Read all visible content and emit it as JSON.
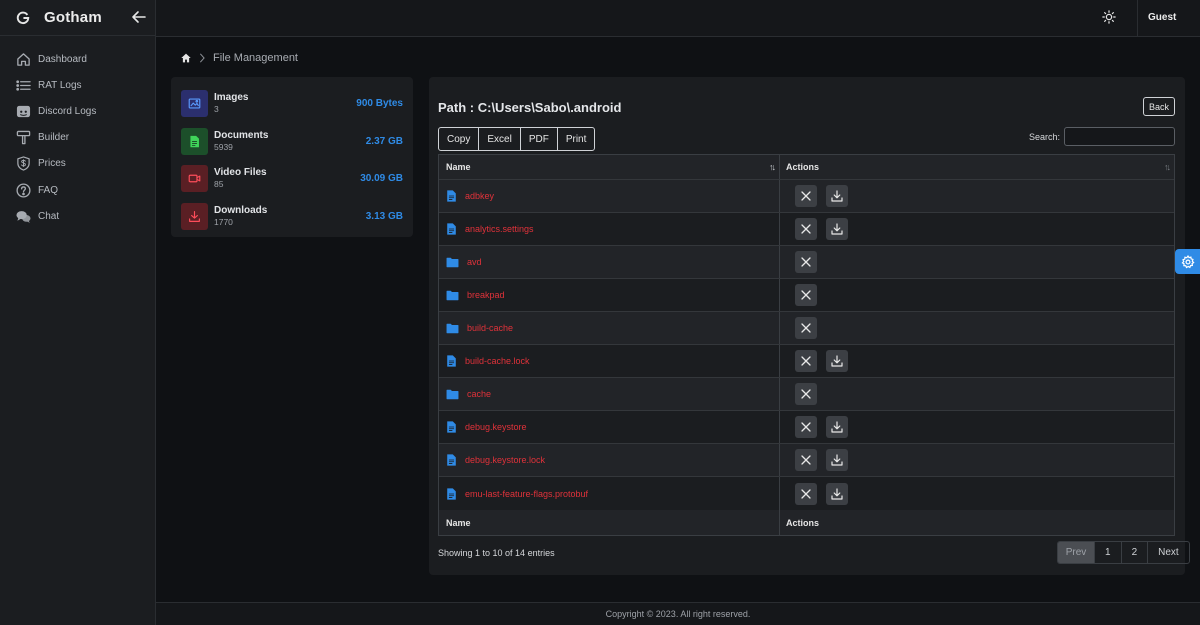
{
  "brand": {
    "name": "Gotham"
  },
  "sidebar": {
    "items": [
      {
        "label": "Dashboard",
        "icon": "home-icon"
      },
      {
        "label": "RAT Logs",
        "icon": "list-icon"
      },
      {
        "label": "Discord Logs",
        "icon": "discord-icon"
      },
      {
        "label": "Builder",
        "icon": "hammer-icon"
      },
      {
        "label": "Prices",
        "icon": "dollar-shield-icon"
      },
      {
        "label": "FAQ",
        "icon": "question-icon"
      },
      {
        "label": "Chat",
        "icon": "chat-icon"
      }
    ]
  },
  "topbar": {
    "user": "Guest"
  },
  "breadcrumb": {
    "current": "File Management"
  },
  "stats": [
    {
      "label": "Images",
      "count": "3",
      "size": "900 Bytes",
      "icon": "image-icon",
      "bg": "#2b2f6e",
      "fg": "#5a9bff"
    },
    {
      "label": "Documents",
      "count": "5939",
      "size": "2.37 GB",
      "icon": "document-icon",
      "bg": "#1c4f2a",
      "fg": "#3fd45a"
    },
    {
      "label": "Video Files",
      "count": "85",
      "size": "30.09 GB",
      "icon": "video-icon",
      "bg": "#5a1f24",
      "fg": "#ff4d5a"
    },
    {
      "label": "Downloads",
      "count": "1770",
      "size": "3.13 GB",
      "icon": "download-icon",
      "bg": "#5a1f24",
      "fg": "#ff4d5a"
    }
  ],
  "main": {
    "path": "Path : C:\\Users\\Sabo\\.android",
    "back_label": "Back",
    "export_buttons": [
      "Copy",
      "Excel",
      "PDF",
      "Print"
    ],
    "search_label": "Search:",
    "search_value": "",
    "table": {
      "header_name": "Name",
      "header_actions": "Actions",
      "rows": [
        {
          "name": "adbkey",
          "type": "file"
        },
        {
          "name": "analytics.settings",
          "type": "file"
        },
        {
          "name": "avd",
          "type": "folder"
        },
        {
          "name": "breakpad",
          "type": "folder"
        },
        {
          "name": "build-cache",
          "type": "folder"
        },
        {
          "name": "build-cache.lock",
          "type": "file"
        },
        {
          "name": "cache",
          "type": "folder"
        },
        {
          "name": "debug.keystore",
          "type": "file"
        },
        {
          "name": "debug.keystore.lock",
          "type": "file"
        },
        {
          "name": "emu-last-feature-flags.protobuf",
          "type": "file"
        }
      ],
      "footer_name": "Name",
      "footer_actions": "Actions"
    },
    "info": "Showing 1 to 10 of 14 entries",
    "pagination": {
      "prev": "Prev",
      "pages": [
        "1",
        "2"
      ],
      "next": "Next"
    }
  },
  "footer": {
    "text": "Copyright © 2023. All right reserved."
  },
  "colors": {
    "accent": "#2f8be6",
    "link": "#e0323a"
  }
}
